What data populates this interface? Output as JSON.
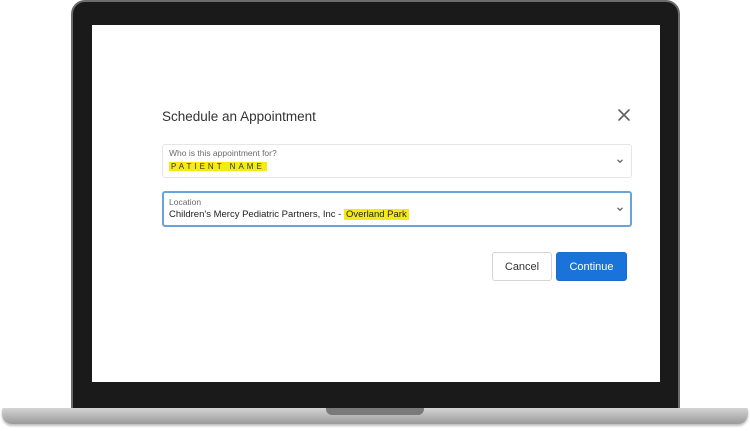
{
  "dialog": {
    "title": "Schedule an Appointment",
    "patient_field": {
      "label": "Who is this appointment for?",
      "value": "PATIENT NAME"
    },
    "location_field": {
      "label": "Location",
      "value_prefix": "Children's Mercy Pediatric Partners, Inc - ",
      "value_highlight": "Overland Park"
    },
    "cancel_label": "Cancel",
    "continue_label": "Continue"
  },
  "colors": {
    "primary": "#1a73d9",
    "highlight": "#f6ea12",
    "focus_border": "#6aa3da"
  },
  "icons": {
    "close": "close-icon",
    "chevron": "chevron-down-icon"
  }
}
